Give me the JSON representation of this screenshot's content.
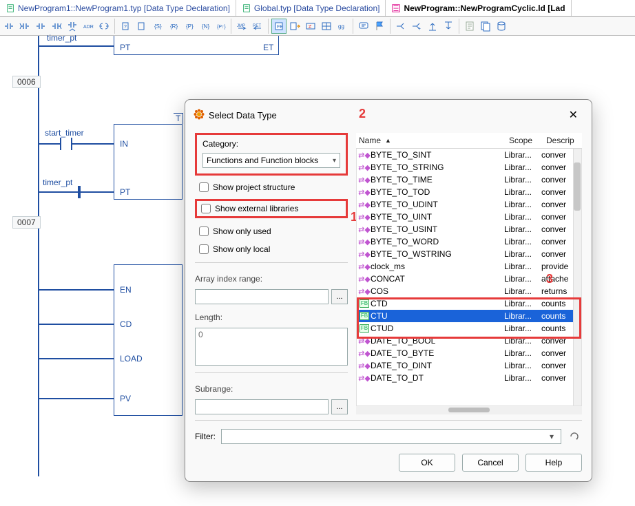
{
  "tabs": [
    {
      "label": "NewProgram1::NewProgram1.typ [Data Type Declaration]",
      "active": false
    },
    {
      "label": "Global.typ [Data Type Declaration]",
      "active": false
    },
    {
      "label": "NewProgram::NewProgramCyclic.ld [Lad",
      "active": true
    }
  ],
  "ladder": {
    "rungs": [
      "0006",
      "0007"
    ],
    "labels": {
      "start_timer": "start_timer",
      "timer_pt": "timer_pt",
      "pt": "PT",
      "et": "ET",
      "in": "IN",
      "en": "EN",
      "cd": "CD",
      "load": "LOAD",
      "pv": "PV",
      "t": "T"
    }
  },
  "dialog": {
    "title": "Select Data Type",
    "category_label": "Category:",
    "category_value": "Functions and Function blocks",
    "checks": {
      "project_structure": "Show project structure",
      "external_libraries": "Show external libraries",
      "only_used": "Show only used",
      "only_local": "Show only local"
    },
    "array_label": "Array index range:",
    "length_label": "Length:",
    "length_value": "0",
    "subrange_label": "Subrange:",
    "filter_label": "Filter:",
    "cols": {
      "name": "Name",
      "scope": "Scope",
      "desc": "Descrip"
    },
    "rows": [
      {
        "icon": "fn",
        "name": "BYTE_TO_SINT",
        "scope": "Librar...",
        "desc": "conver"
      },
      {
        "icon": "fn",
        "name": "BYTE_TO_STRING",
        "scope": "Librar...",
        "desc": "conver"
      },
      {
        "icon": "fn",
        "name": "BYTE_TO_TIME",
        "scope": "Librar...",
        "desc": "conver"
      },
      {
        "icon": "fn",
        "name": "BYTE_TO_TOD",
        "scope": "Librar...",
        "desc": "conver"
      },
      {
        "icon": "fn",
        "name": "BYTE_TO_UDINT",
        "scope": "Librar...",
        "desc": "conver"
      },
      {
        "icon": "fn",
        "name": "BYTE_TO_UINT",
        "scope": "Librar...",
        "desc": "conver"
      },
      {
        "icon": "fn",
        "name": "BYTE_TO_USINT",
        "scope": "Librar...",
        "desc": "conver"
      },
      {
        "icon": "fn",
        "name": "BYTE_TO_WORD",
        "scope": "Librar...",
        "desc": "conver"
      },
      {
        "icon": "fn",
        "name": "BYTE_TO_WSTRING",
        "scope": "Librar...",
        "desc": "conver"
      },
      {
        "icon": "fn",
        "name": "clock_ms",
        "scope": "Librar...",
        "desc": "provide"
      },
      {
        "icon": "fn",
        "name": "CONCAT",
        "scope": "Librar...",
        "desc": "attache"
      },
      {
        "icon": "fn",
        "name": "COS",
        "scope": "Librar...",
        "desc": "returns"
      },
      {
        "icon": "fb",
        "name": "CTD",
        "scope": "Librar...",
        "desc": "counts"
      },
      {
        "icon": "fb",
        "name": "CTU",
        "scope": "Librar...",
        "desc": "counts",
        "selected": true
      },
      {
        "icon": "fb",
        "name": "CTUD",
        "scope": "Librar...",
        "desc": "counts"
      },
      {
        "icon": "fn",
        "name": "DATE_TO_BOOL",
        "scope": "Librar...",
        "desc": "conver"
      },
      {
        "icon": "fn",
        "name": "DATE_TO_BYTE",
        "scope": "Librar...",
        "desc": "conver"
      },
      {
        "icon": "fn",
        "name": "DATE_TO_DINT",
        "scope": "Librar...",
        "desc": "conver"
      },
      {
        "icon": "fn",
        "name": "DATE_TO_DT",
        "scope": "Librar...",
        "desc": "conver"
      }
    ],
    "buttons": {
      "ok": "OK",
      "cancel": "Cancel",
      "help": "Help"
    }
  },
  "annotations": {
    "one": "1",
    "two": "2",
    "three": "3"
  }
}
